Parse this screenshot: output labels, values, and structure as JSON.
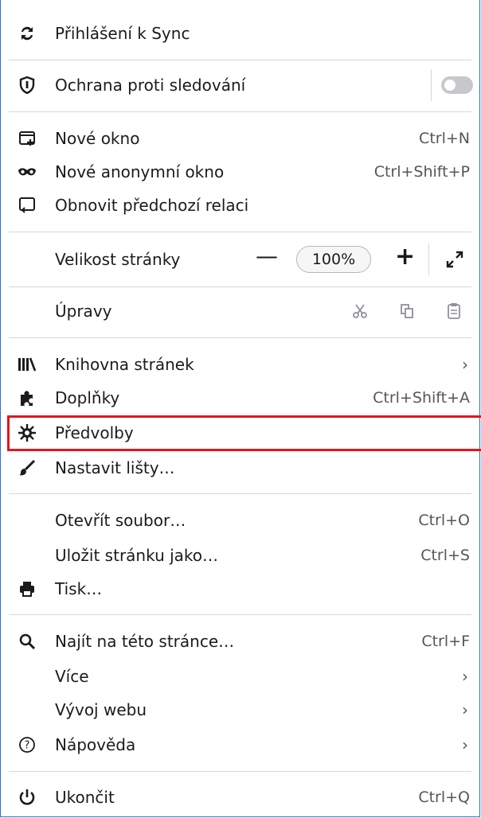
{
  "menu": {
    "sync": {
      "label": "Přihlášení k Sync",
      "icon": "sync-icon"
    },
    "tracking": {
      "label": "Ochrana proti sledování",
      "icon": "shield-icon"
    },
    "new_window": {
      "label": "Nové okno",
      "shortcut": "Ctrl+N",
      "icon": "new-window-icon"
    },
    "private_window": {
      "label": "Nové anonymní okno",
      "shortcut": "Ctrl+Shift+P",
      "icon": "mask-icon"
    },
    "restore_session": {
      "label": "Obnovit předchozí relaci",
      "icon": "restore-session-icon"
    },
    "zoom": {
      "label": "Velikost stránky",
      "minus": "—",
      "value": "100%",
      "plus": "+"
    },
    "edit": {
      "label": "Úpravy"
    },
    "library": {
      "label": "Knihovna stránek",
      "chevron": "›",
      "icon": "library-icon"
    },
    "addons": {
      "label": "Doplňky",
      "shortcut": "Ctrl+Shift+A",
      "icon": "puzzle-icon"
    },
    "preferences": {
      "label": "Předvolby",
      "icon": "gear-icon"
    },
    "customize": {
      "label": "Nastavit lišty…",
      "icon": "brush-icon"
    },
    "open_file": {
      "label": "Otevřít soubor…",
      "shortcut": "Ctrl+O"
    },
    "save_page": {
      "label": "Uložit stránku jako…",
      "shortcut": "Ctrl+S"
    },
    "print": {
      "label": "Tisk…",
      "icon": "printer-icon"
    },
    "find": {
      "label": "Najít na této stránce…",
      "shortcut": "Ctrl+F",
      "icon": "search-icon"
    },
    "more": {
      "label": "Více",
      "chevron": "›"
    },
    "web_dev": {
      "label": "Vývoj webu",
      "chevron": "›"
    },
    "help": {
      "label": "Nápověda",
      "chevron": "›",
      "icon": "help-icon"
    },
    "quit": {
      "label": "Ukončit",
      "shortcut": "Ctrl+Q",
      "icon": "power-icon"
    }
  },
  "colors": {
    "highlight": "#e8141e",
    "border": "#2b6fc7"
  }
}
